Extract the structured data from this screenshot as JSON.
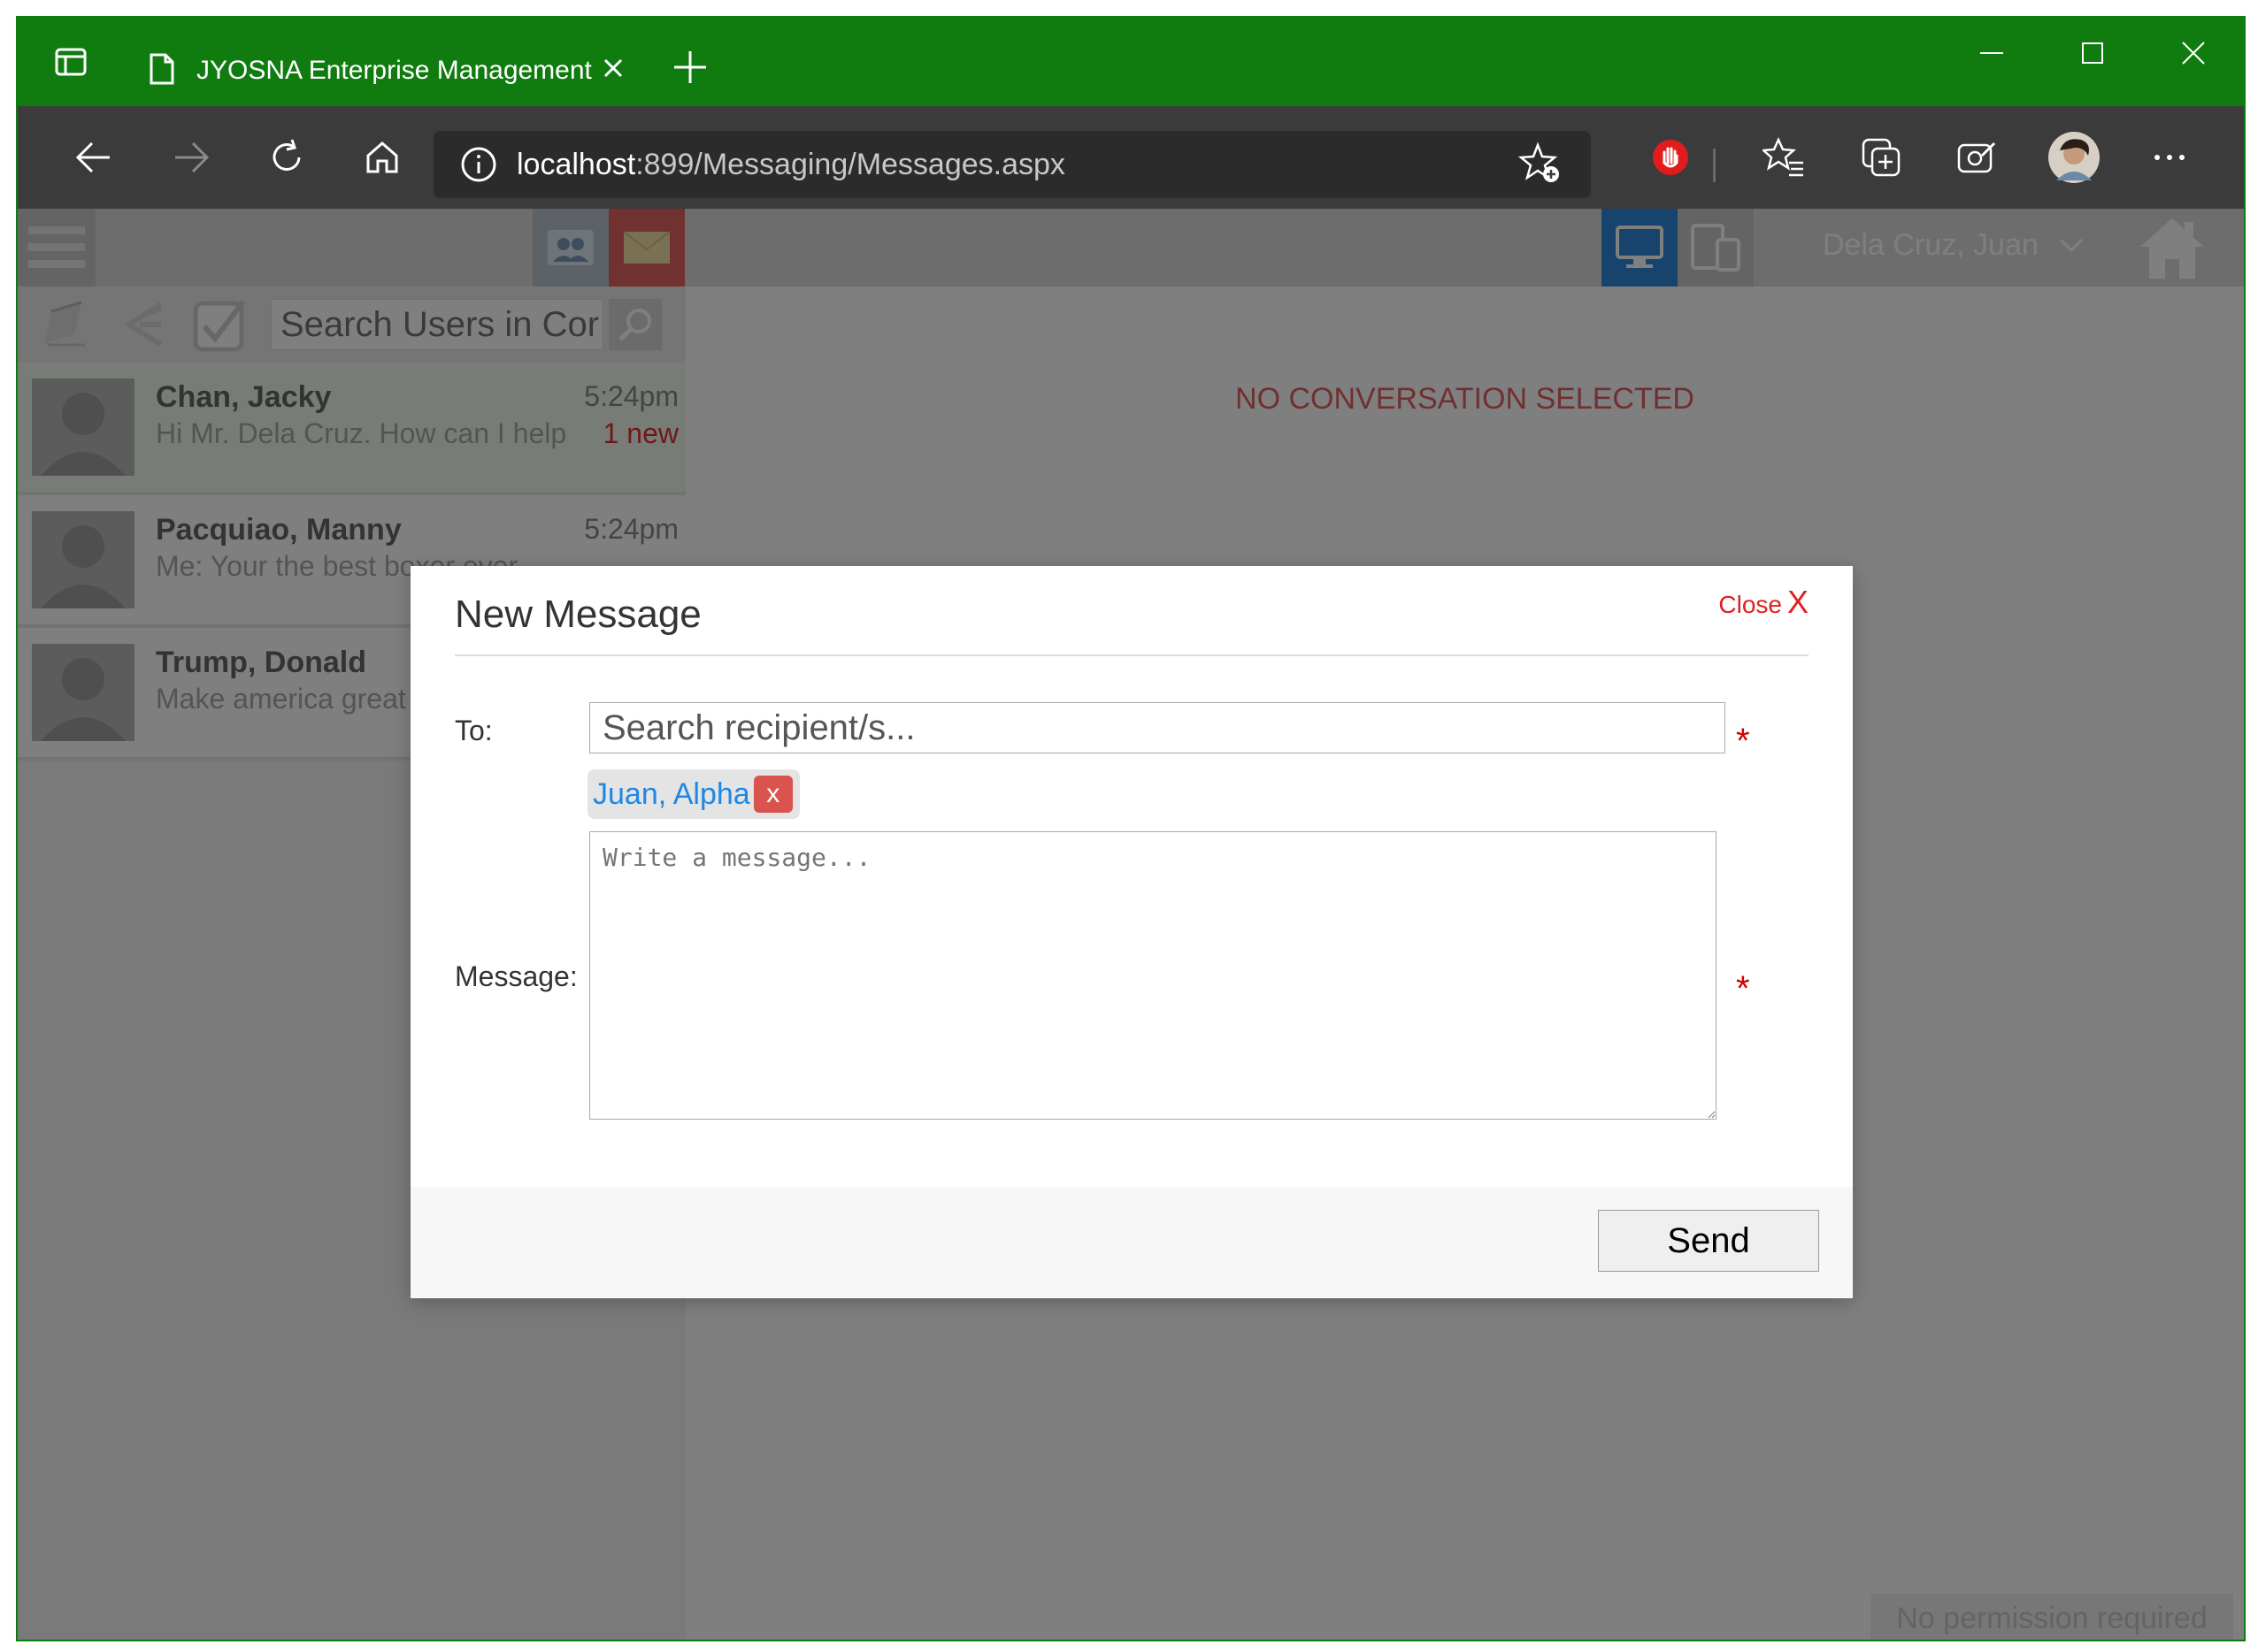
{
  "browser": {
    "tab_title": "JYOSNA Enterprise Management",
    "url_host": "localhost",
    "url_path": ":899/Messaging/Messages.aspx"
  },
  "app": {
    "user_name": "Dela Cruz, Juan",
    "search_placeholder": "Search Users in Cor",
    "no_conversation_text": "NO CONVERSATION SELECTED",
    "permission_text": "No permission required"
  },
  "conversations": [
    {
      "name": "Chan, Jacky",
      "time": "5:24pm",
      "preview": "Hi Mr. Dela Cruz. How can I help you?",
      "new_badge": "1 new"
    },
    {
      "name": "Pacquiao, Manny",
      "time": "5:24pm",
      "preview": "Me: Your the best boxer ever",
      "new_badge": ""
    },
    {
      "name": "Trump, Donald",
      "time": "",
      "preview": "Make america great again",
      "new_badge": ""
    }
  ],
  "modal": {
    "title": "New Message",
    "close_text": "Close",
    "close_x": "X",
    "to_label": "To:",
    "recipient_placeholder": "Search recipient/s...",
    "required_mark": "*",
    "recipient_chip": "Juan, Alpha",
    "chip_remove": "x",
    "message_label": "Message:",
    "message_placeholder": "Write a message...",
    "send_label": "Send"
  },
  "colors": {
    "browser_accent": "#107c10",
    "toolbar": "#3b3b3b",
    "close_red": "#e02020",
    "chip_blue": "#1e88e5",
    "chip_remove_red": "#d9534f"
  },
  "icons": {
    "tab_actions": "tab-actions-icon",
    "page": "page-icon",
    "back": "back-arrow-icon",
    "forward": "forward-arrow-icon",
    "refresh": "refresh-icon",
    "home": "home-icon",
    "info": "info-icon",
    "add_favorite": "add-favorite-icon",
    "adblock": "adblock-hand-icon",
    "favorites": "favorites-icon",
    "collections": "collections-icon",
    "feedback": "feedback-icon",
    "profile": "profile-avatar",
    "more": "more-icon"
  }
}
